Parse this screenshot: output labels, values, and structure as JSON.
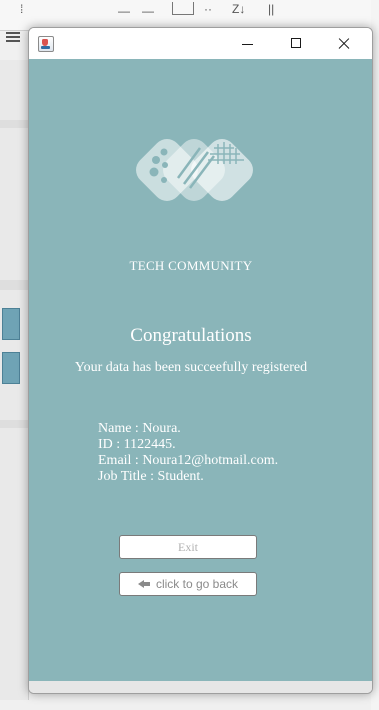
{
  "window": {
    "controls": [
      "minimize",
      "maximize",
      "close"
    ]
  },
  "brand": {
    "name": "TECH COMMUNITY"
  },
  "message": {
    "title": "Congratulations",
    "subtitle": "Your data has been succeefully registered"
  },
  "details": {
    "name": "Name : Noura.",
    "id": "ID : 1122445.",
    "email": "Email : Noura12@hotmail.com.",
    "job_title": "Job Title : Student."
  },
  "buttons": {
    "exit_label": "Exit",
    "back_label": "click to go back",
    "back_icon": "arrow-left-icon"
  },
  "colors": {
    "panel_background": "#8ab5b9",
    "text": "#ffffff",
    "button_background": "#ffffff"
  }
}
